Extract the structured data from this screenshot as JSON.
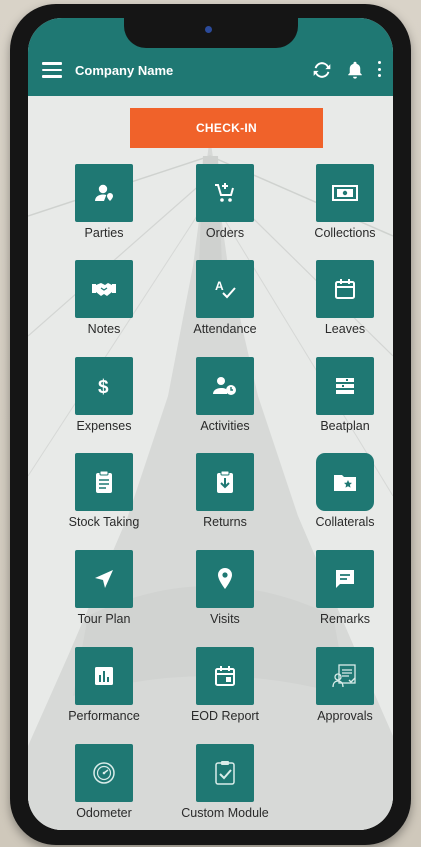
{
  "app": {
    "title": "Company Name",
    "accent_color": "#1f7873",
    "checkin_color": "#f0622a"
  },
  "toolbar": {
    "menu_icon": "hamburger-icon",
    "refresh_icon": "refresh-icon",
    "notification_icon": "bell-icon",
    "more_icon": "more-vert-icon"
  },
  "checkin": {
    "label": "CHECK-IN"
  },
  "modules": [
    {
      "label": "Parties",
      "icon": "person-pin-icon"
    },
    {
      "label": "Orders",
      "icon": "cart-add-icon"
    },
    {
      "label": "Collections",
      "icon": "cash-icon"
    },
    {
      "label": "Notes",
      "icon": "handshake-icon"
    },
    {
      "label": "Attendance",
      "icon": "spellcheck-icon"
    },
    {
      "label": "Leaves",
      "icon": "calendar-icon"
    },
    {
      "label": "Expenses",
      "icon": "dollar-icon"
    },
    {
      "label": "Activities",
      "icon": "person-clock-icon"
    },
    {
      "label": "Beatplan",
      "icon": "list-icon"
    },
    {
      "label": "Stock Taking",
      "icon": "clipboard-list-icon"
    },
    {
      "label": "Returns",
      "icon": "return-box-icon"
    },
    {
      "label": "Collaterals",
      "icon": "folder-star-icon"
    },
    {
      "label": "Tour Plan",
      "icon": "navigation-arrow-icon"
    },
    {
      "label": "Visits",
      "icon": "location-pin-icon"
    },
    {
      "label": "Remarks",
      "icon": "comment-icon"
    },
    {
      "label": "Performance",
      "icon": "bar-chart-icon"
    },
    {
      "label": "EOD Report",
      "icon": "event-calendar-icon"
    },
    {
      "label": "Approvals",
      "icon": "approval-icon"
    },
    {
      "label": "Odometer",
      "icon": "speedometer-icon"
    },
    {
      "label": "Custom Module",
      "icon": "checklist-icon"
    }
  ]
}
